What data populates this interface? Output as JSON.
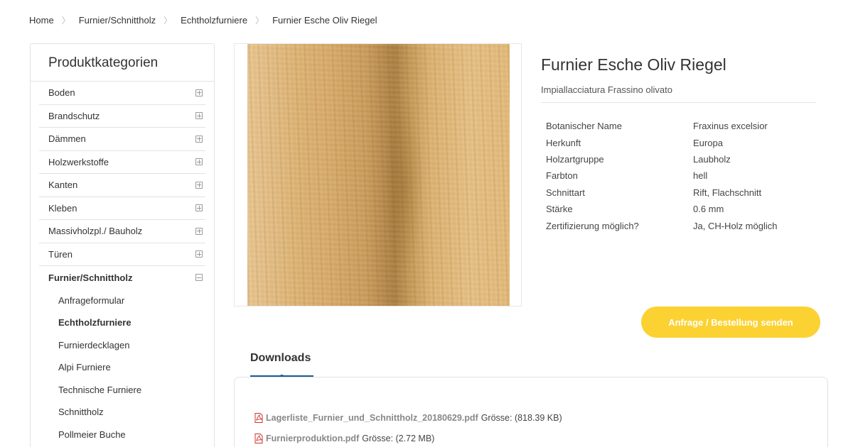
{
  "breadcrumb": [
    {
      "label": "Home"
    },
    {
      "label": "Furnier/Schnittholz"
    },
    {
      "label": "Echtholzfurniere"
    },
    {
      "label": "Furnier Esche Oliv Riegel"
    }
  ],
  "sidebar": {
    "title": "Produktkategorien",
    "categories": [
      {
        "label": "Boden",
        "expanded": false
      },
      {
        "label": "Brandschutz",
        "expanded": false
      },
      {
        "label": "Dämmen",
        "expanded": false
      },
      {
        "label": "Holzwerkstoffe",
        "expanded": false
      },
      {
        "label": "Kanten",
        "expanded": false
      },
      {
        "label": "Kleben",
        "expanded": false
      },
      {
        "label": "Massivholzpl./ Bauholz",
        "expanded": false
      },
      {
        "label": "Türen",
        "expanded": false
      },
      {
        "label": "Furnier/Schnittholz",
        "expanded": true,
        "active": true
      }
    ],
    "subitems": [
      {
        "label": "Anfrageformular"
      },
      {
        "label": "Echtholzfurniere",
        "active": true
      },
      {
        "label": "Furnierdecklagen"
      },
      {
        "label": "Alpi Furniere"
      },
      {
        "label": "Technische Furniere"
      },
      {
        "label": "Schnittholz"
      },
      {
        "label": "Pollmeier Buche"
      }
    ]
  },
  "product": {
    "title": "Furnier Esche Oliv Riegel",
    "subtitle": "Impiallacciatura Frassino olivato",
    "properties": [
      {
        "key": "Botanischer Name",
        "value": "Fraxinus excelsior"
      },
      {
        "key": "Herkunft",
        "value": "Europa"
      },
      {
        "key": "Holzartgruppe",
        "value": "Laubholz"
      },
      {
        "key": "Farbton",
        "value": "hell"
      },
      {
        "key": "Schnittart",
        "value": "Rift, Flachschnitt"
      },
      {
        "key": "Stärke",
        "value": "0.6 mm"
      },
      {
        "key": "Zertifizierung möglich?",
        "value": "Ja, CH-Holz möglich"
      }
    ]
  },
  "order_button": {
    "label": "Anfrage / Bestellung senden"
  },
  "downloads": {
    "tab_label": "Downloads",
    "items": [
      {
        "file": "Lagerliste_Furnier_und_Schnittholz_20180629.pdf",
        "meta": "Grösse: (818.39 KB)"
      },
      {
        "file": "Furnierproduktion.pdf",
        "meta": "Grösse: (2.72 MB)"
      }
    ]
  },
  "colors": {
    "accent_yellow": "#fcd232",
    "tab_blue": "#1e5a96",
    "pdf_red": "#d0312d"
  }
}
